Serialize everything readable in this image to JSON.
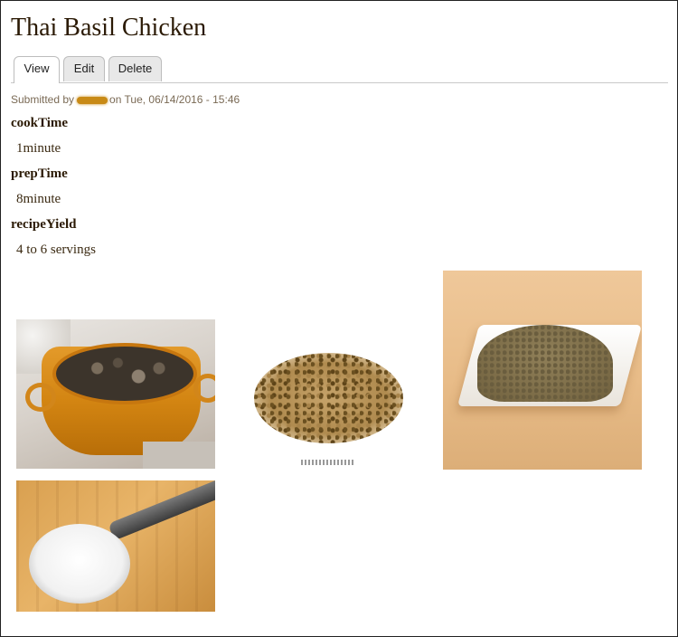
{
  "page": {
    "title": "Thai Basil Chicken"
  },
  "tabs": [
    {
      "label": "View",
      "active": true
    },
    {
      "label": "Edit",
      "active": false
    },
    {
      "label": "Delete",
      "active": false
    }
  ],
  "meta": {
    "submitted_prefix": "Submitted by",
    "submitted_suffix": "on Tue, 06/14/2016 - 15:46"
  },
  "fields": [
    {
      "label": "cookTime",
      "value": "1minute"
    },
    {
      "label": "prepTime",
      "value": "8minute"
    },
    {
      "label": "recipeYield",
      "value": "4 to 6 servings"
    }
  ],
  "images": [
    {
      "name": "pot-of-stew-image"
    },
    {
      "name": "seed-heap-image"
    },
    {
      "name": "spice-powder-on-plate-image"
    },
    {
      "name": "measuring-scoop-image"
    }
  ]
}
